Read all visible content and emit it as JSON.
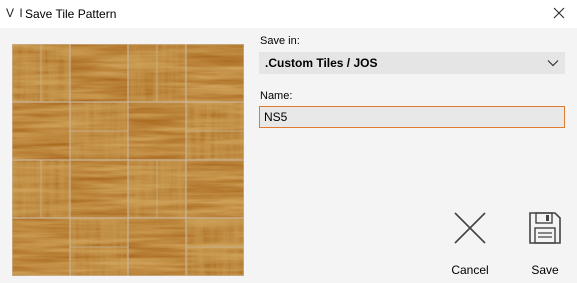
{
  "window": {
    "title": "Save Tile Pattern",
    "app_icon_text": "V I",
    "close_icon": "close-icon"
  },
  "preview": {
    "grout_color": "#c9b59a",
    "tile_color": "#a9691f",
    "tile_dark": "#7a4712",
    "tile_light": "#c88a3a"
  },
  "form": {
    "save_in_label": "Save in:",
    "save_in_value": ".Custom Tiles / JOS",
    "name_label": "Name:",
    "name_value": "NS5"
  },
  "actions": {
    "cancel_label": "Cancel",
    "cancel_icon": "x-icon",
    "save_label": "Save",
    "save_icon": "floppy-disk-icon"
  },
  "colors": {
    "input_focus_border": "#e07a2e",
    "field_background": "#e5e5e5"
  }
}
